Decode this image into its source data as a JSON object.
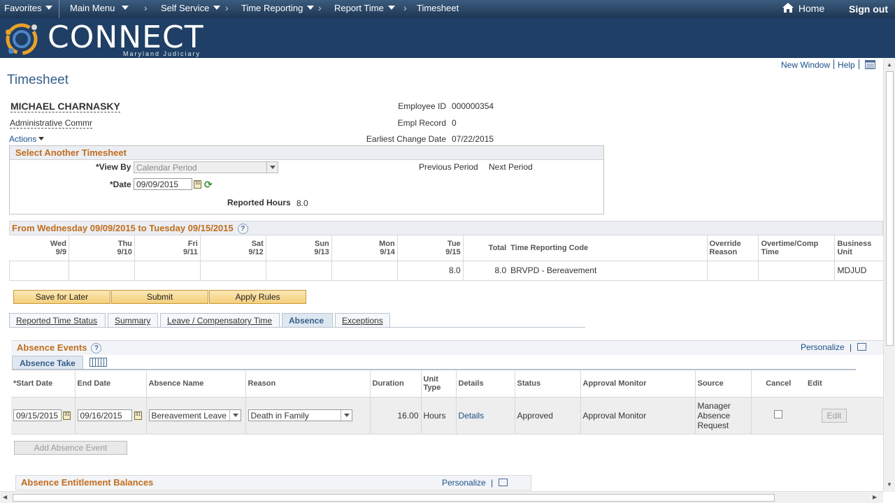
{
  "topnav": {
    "favorites": "Favorites",
    "main_menu": "Main Menu",
    "breadcrumb": [
      "Self Service",
      "Time Reporting",
      "Report Time",
      "Timesheet"
    ],
    "home": "Home",
    "signout": "Sign out"
  },
  "banner": {
    "logo": "CONNECT",
    "logo_sub": "Maryland Judiciary"
  },
  "page_links": {
    "new_window": "New Window",
    "help": "Help"
  },
  "page": {
    "title": "Timesheet"
  },
  "employee": {
    "name": "MICHAEL CHARNASKY",
    "title": "Administrative Commr",
    "actions": "Actions",
    "id_label": "Employee ID",
    "id": "000000354",
    "rec_label": "Empl Record",
    "rec": "0",
    "ecd_label": "Earliest Change Date",
    "ecd": "07/22/2015"
  },
  "select_ts": {
    "title": "Select Another Timesheet",
    "view_by_label": "*View By",
    "view_by": "Calendar Period",
    "date_label": "*Date",
    "date": "09/09/2015",
    "prev": "Previous Period",
    "next": "Next Period",
    "reported_label": "Reported Hours",
    "reported": "8.0"
  },
  "period": {
    "title": "From Wednesday 09/09/2015 to Tuesday 09/15/2015",
    "days": [
      {
        "d": "Wed",
        "n": "9/9",
        "v": ""
      },
      {
        "d": "Thu",
        "n": "9/10",
        "v": ""
      },
      {
        "d": "Fri",
        "n": "9/11",
        "v": ""
      },
      {
        "d": "Sat",
        "n": "9/12",
        "v": ""
      },
      {
        "d": "Sun",
        "n": "9/13",
        "v": ""
      },
      {
        "d": "Mon",
        "n": "9/14",
        "v": ""
      },
      {
        "d": "Tue",
        "n": "9/15",
        "v": "8.0"
      }
    ],
    "total_h": "Total",
    "total": "8.0",
    "trc_h": "Time Reporting Code",
    "trc": "BRVPD - Bereavement",
    "override_h1": "Override",
    "override_h2": "Reason",
    "override": "",
    "ot_h1": "Overtime/Comp",
    "ot_h2": "Time",
    "ot": "",
    "bu_h1": "Business",
    "bu_h2": "Unit",
    "bu": "MDJUD"
  },
  "buttons": {
    "save": "Save for Later",
    "submit": "Submit",
    "apply": "Apply Rules"
  },
  "tabs": [
    "Reported Time Status",
    "Summary",
    "Leave / Compensatory Time",
    "Absence",
    "Exceptions"
  ],
  "absence": {
    "title": "Absence Events",
    "personalize": "Personalize",
    "subtab": "Absence Take",
    "headers": {
      "start": "*Start Date",
      "end": "End Date",
      "name": "Absence Name",
      "reason": "Reason",
      "duration": "Duration",
      "unit1": "Unit",
      "unit2": "Type",
      "details": "Details",
      "status": "Status",
      "approval": "Approval Monitor",
      "source": "Source",
      "cancel": "Cancel",
      "edit": "Edit"
    },
    "row": {
      "start": "09/15/2015",
      "end": "09/16/2015",
      "name": "Bereavement Leave",
      "reason": "Death in Family",
      "duration": "16.00",
      "unit": "Hours",
      "details": "Details",
      "status": "Approved",
      "approval": "Approval Monitor",
      "source1": "Manager",
      "source2": "Absence",
      "source3": "Request",
      "edit": "Edit"
    },
    "add_btn": "Add Absence Event"
  },
  "entitlement": {
    "title": "Absence Entitlement Balances",
    "personalize": "Personalize"
  },
  "colors": {
    "nav": "#1f3f66",
    "section": "#c16d1e",
    "link": "#1a4f88",
    "button": "#f5cf7c"
  }
}
